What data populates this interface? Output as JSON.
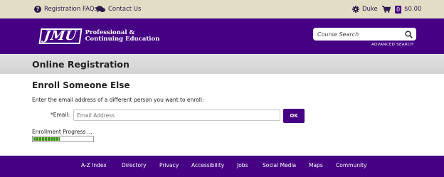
{
  "topbar": {
    "faq_label": "Registration FAQs",
    "contact_label": "Contact Us",
    "user_label": "Duke",
    "cart_count": "0",
    "cart_total": "$0.00"
  },
  "header": {
    "logo_mark": "JMU",
    "logo_line1": "Professional &",
    "logo_line2": "Continuing Education",
    "search_placeholder": "Course Search",
    "advanced_search_label": "ADVANCED SEARCH"
  },
  "page": {
    "title": "Online Registration"
  },
  "enroll": {
    "section_title": "Enroll Someone Else",
    "instruction": "Enter the email address of a different person you want to enroll:",
    "email_label": "*Email:",
    "email_placeholder": "Email Address",
    "email_value": "",
    "ok_label": "OK",
    "progress_label": "Enrollment Progress ...",
    "progress_fraction": 0.45
  },
  "footer": {
    "links": [
      "A-Z Index",
      "Directory",
      "Privacy",
      "Accessibility",
      "Jobs",
      "Social Media",
      "Maps",
      "Community"
    ]
  },
  "colors": {
    "brand_purple": "#450084",
    "topbar_bg": "#e4ddc6",
    "progress_green": "#3f8f1a"
  },
  "icons": {
    "faq": "question-circle-icon",
    "contact": "chat-bubbles-icon",
    "user": "gear-icon",
    "cart": "shopping-cart-icon",
    "search": "search-icon"
  }
}
